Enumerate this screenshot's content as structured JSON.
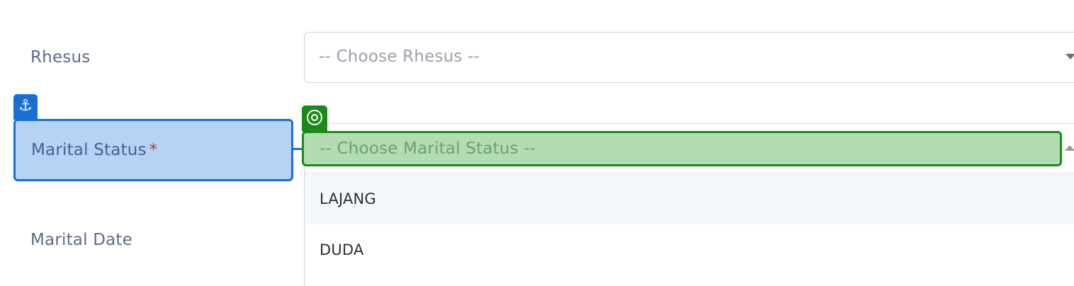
{
  "form": {
    "rhesus": {
      "label": "Rhesus",
      "placeholder": "-- Choose Rhesus --"
    },
    "marital_status": {
      "label": "Marital Status",
      "required_mark": "*",
      "placeholder": "-- Choose Marital Status --",
      "options": [
        "LAJANG",
        "DUDA"
      ],
      "highlighted_option": "LAJANG"
    },
    "marital_date": {
      "label": "Marital Date"
    }
  },
  "annotations": {
    "anchor_icon": "⚓",
    "anchor_color": "#1a6fd6",
    "target_color": "#1b8a1b"
  }
}
